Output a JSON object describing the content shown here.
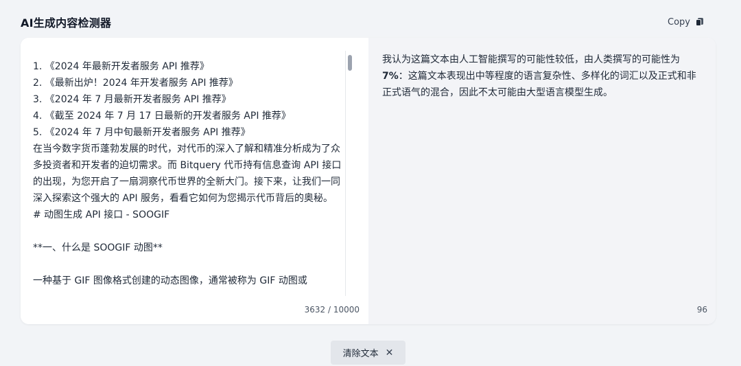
{
  "header": {
    "title": "AI生成内容检测器",
    "copy_label": "Copy",
    "copy_icon": "copy-icon"
  },
  "editor": {
    "text": "1. 《2024 年最新开发者服务 API 推荐》\n2. 《最新出炉！2024 年开发者服务 API 推荐》\n3. 《2024 年 7 月最新开发者服务 API 推荐》\n4. 《截至 2024 年 7 月 17 日最新的开发者服务 API 推荐》\n5. 《2024 年 7 月中旬最新开发者服务 API 推荐》\n在当今数字货币蓬勃发展的时代，对代币的深入了解和精准分析成为了众多投资者和开发者的迫切需求。而 Bitquery 代币持有信息查询 API 接口的出现，为您开启了一扇洞察代币世界的全新大门。接下来，让我们一同深入探索这个强大的 API 服务，看看它如何为您揭示代币背后的奥秘。\n# 动图生成 API 接口 - SOOGIF\n\n**一、什么是 SOOGIF 动图**\n\n一种基于 GIF 图像格式创建的动态图像，通常被称为 GIF 动图或",
    "char_count": "3632 / 10000"
  },
  "result": {
    "prefix": "我认为这篇文本由人工智能撰写的可能性较低，由人类撰写的可能性为 ",
    "percent": "7%",
    "suffix": "：这篇文本表现出中等程度的语言复杂性、多样化的词汇以及正式和非正式语气的混合，因此不太可能由大型语言模型生成。",
    "score": "96"
  },
  "footer": {
    "clear_label": "清除文本",
    "clear_icon": "close-icon",
    "clear_icon_glyph": "✕"
  }
}
